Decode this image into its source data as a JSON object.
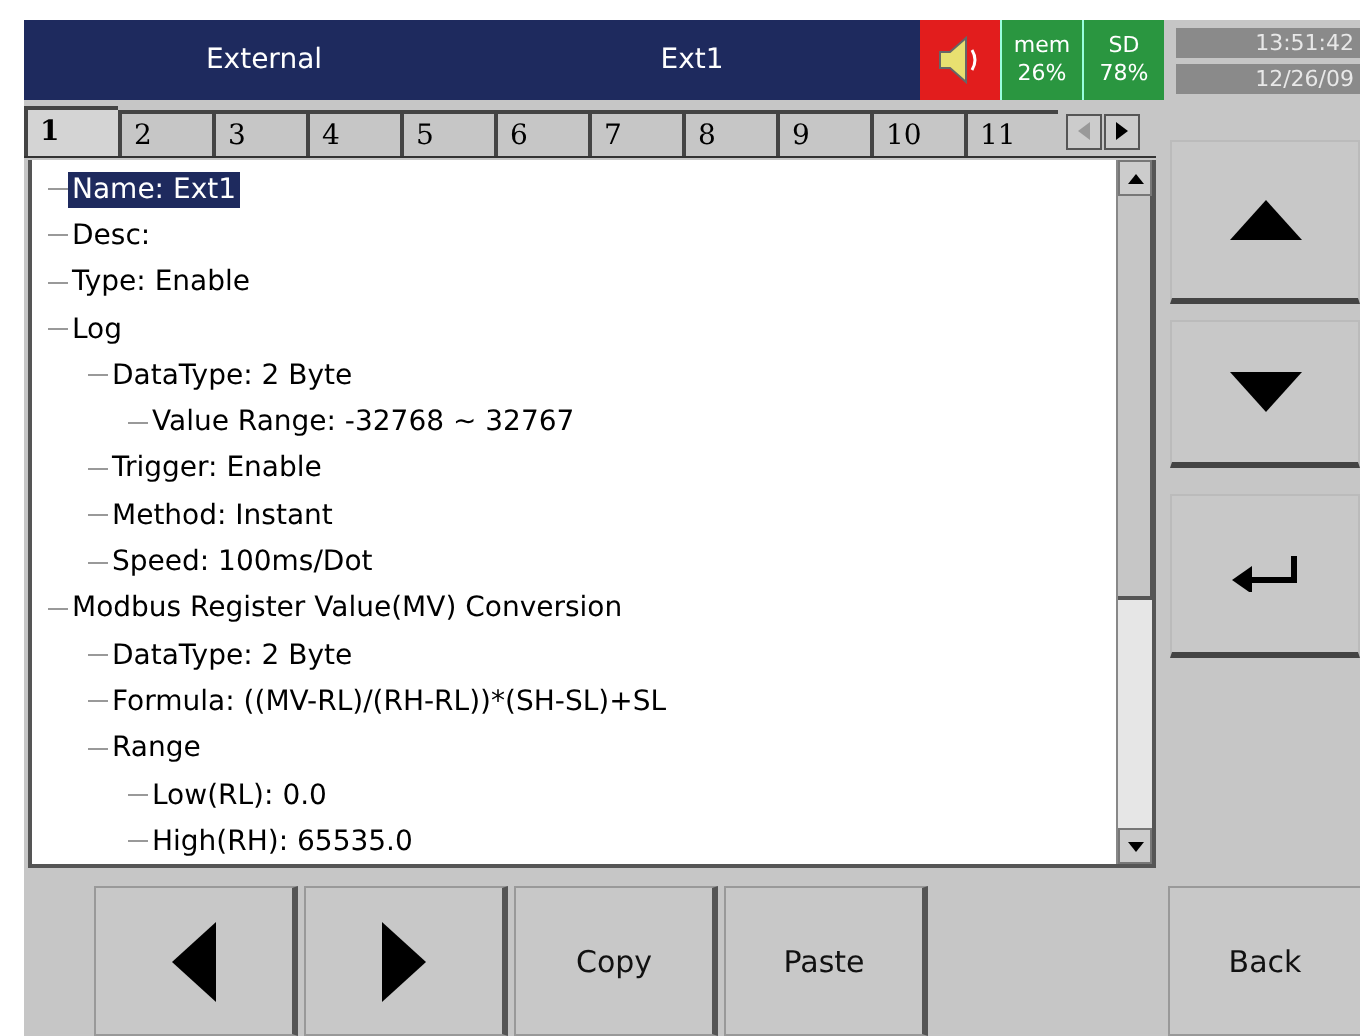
{
  "header": {
    "section": "External",
    "title": "Ext1",
    "alarm_on": true,
    "mem": {
      "label": "mem",
      "value": "26%"
    },
    "sd": {
      "label": "SD",
      "value": "78%"
    },
    "time": "13:51:42",
    "date": "12/26/09"
  },
  "tabs": [
    {
      "label": "1",
      "selected": true
    },
    {
      "label": "2",
      "selected": false
    },
    {
      "label": "3",
      "selected": false
    },
    {
      "label": "4",
      "selected": false
    },
    {
      "label": "5",
      "selected": false
    },
    {
      "label": "6",
      "selected": false
    },
    {
      "label": "7",
      "selected": false
    },
    {
      "label": "8",
      "selected": false
    },
    {
      "label": "9",
      "selected": false
    },
    {
      "label": "10",
      "selected": false
    },
    {
      "label": "11",
      "selected": false
    }
  ],
  "tree": [
    {
      "label": "Name: Ext1",
      "selected": true
    },
    {
      "label": "Desc:",
      "selected": false
    },
    {
      "label": "Type: Enable",
      "selected": false
    },
    {
      "label": "Log",
      "selected": false,
      "children": [
        {
          "label": "DataType: 2 Byte",
          "selected": false,
          "children": [
            {
              "label": "Value Range: -32768 ~ 32767",
              "selected": false
            }
          ]
        },
        {
          "label": "Trigger: Enable",
          "selected": false
        },
        {
          "label": "Method: Instant",
          "selected": false
        },
        {
          "label": "Speed: 100ms/Dot",
          "selected": false
        }
      ]
    },
    {
      "label": "Modbus Register Value(MV) Conversion",
      "selected": false,
      "children": [
        {
          "label": "DataType: 2 Byte",
          "selected": false
        },
        {
          "label": "Formula: ((MV-RL)/(RH-RL))*(SH-SL)+SL",
          "selected": false
        },
        {
          "label": "Range",
          "selected": false,
          "children": [
            {
              "label": "Low(RL): 0.0",
              "selected": false
            },
            {
              "label": "High(RH): 65535.0",
              "selected": false
            }
          ]
        }
      ]
    }
  ],
  "bottom_buttons": [
    {
      "kind": "left"
    },
    {
      "kind": "right"
    },
    {
      "kind": "text",
      "label": "Copy"
    },
    {
      "kind": "text",
      "label": "Paste"
    }
  ],
  "back_button": "Back"
}
